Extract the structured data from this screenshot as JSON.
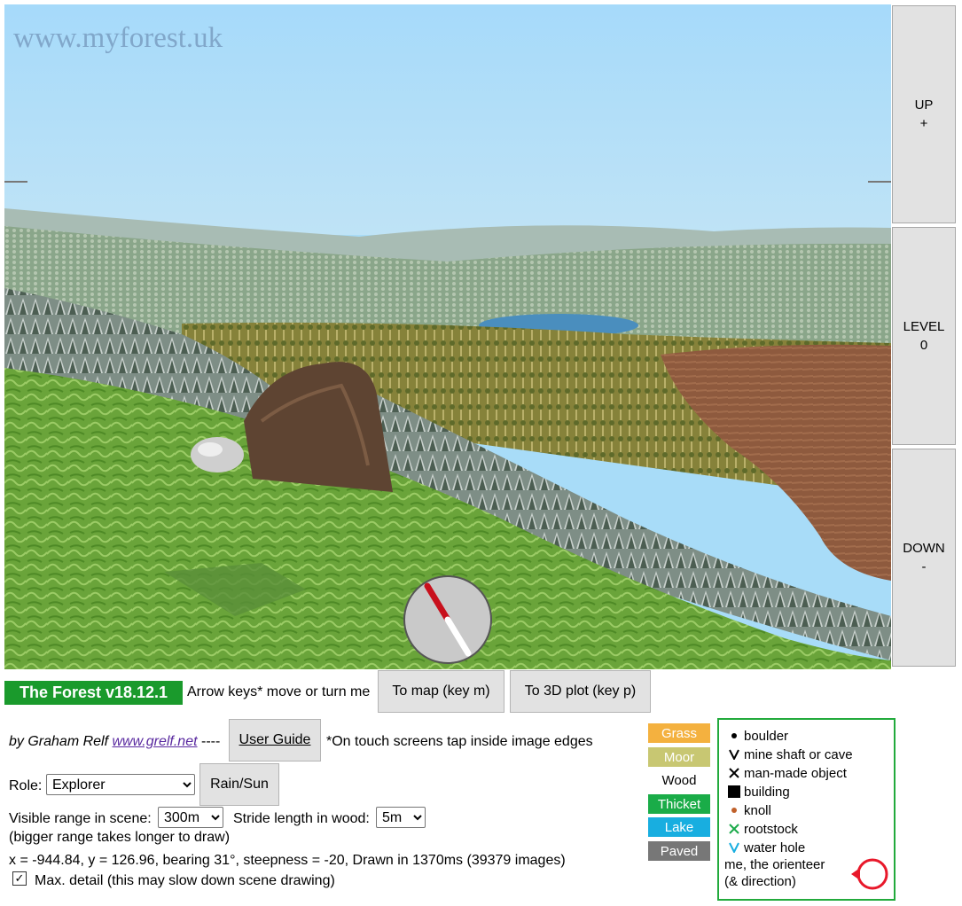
{
  "scene": {
    "watermark": "www.myforest.uk"
  },
  "side_buttons": {
    "up": {
      "line1": "UP",
      "line2": "+"
    },
    "level": {
      "line1": "LEVEL",
      "line2": "0"
    },
    "down": {
      "line1": "DOWN",
      "line2": "-"
    }
  },
  "toolbar": {
    "title": "The Forest v18.12.1",
    "hint": "Arrow keys* move or turn me",
    "to_map": "To map (key m)",
    "to_3d": "To 3D plot (key p)"
  },
  "credits": {
    "by": "by Graham Relf",
    "link": "www.grelf.net",
    "sep": "----",
    "user_guide": "User Guide",
    "touch_note": "*On touch screens tap inside image edges"
  },
  "role": {
    "label": "Role:",
    "value": "Explorer",
    "rain_sun": "Rain/Sun"
  },
  "range": {
    "label": "Visible range in scene:",
    "value": "300m",
    "stride_label": "Stride length in wood:",
    "stride_value": "5m",
    "note": "(bigger range takes longer to draw)"
  },
  "status": {
    "text": "x = -944.84, y = 126.96, bearing 31°, steepness = -20, Drawn in 1370ms (39379 images)"
  },
  "detail": {
    "label": "Max. detail (this may slow down scene drawing)",
    "checked": true
  },
  "terrain_legend": [
    {
      "label": "Grass",
      "color": "#f4b13f"
    },
    {
      "label": "Moor",
      "color": "#c8c772"
    },
    {
      "label": "Wood",
      "color": "#ffffff"
    },
    {
      "label": "Thicket",
      "color": "#1aac48"
    },
    {
      "label": "Lake",
      "color": "#18aee0"
    },
    {
      "label": "Paved",
      "color": "#777777"
    }
  ],
  "symbol_legend": [
    {
      "icon": "boulder-dot-icon",
      "label": "boulder"
    },
    {
      "icon": "mine-shaft-v-icon",
      "label": "mine shaft or cave"
    },
    {
      "icon": "cross-x-icon",
      "label": "man-made object"
    },
    {
      "icon": "building-square-icon",
      "label": "building"
    },
    {
      "icon": "knoll-dot-icon",
      "label": "knoll"
    },
    {
      "icon": "rootstock-x-icon",
      "label": "rootstock"
    },
    {
      "icon": "water-hole-v-icon",
      "label": "water hole"
    }
  ],
  "orienteer": {
    "line1": "me, the orienteer",
    "line2": "(& direction)"
  },
  "colors": {
    "sky": "#a8dcf8",
    "title_green": "#1a9a2c",
    "legend_border": "#22aa3c",
    "orienteer_red": "#e8182a"
  }
}
